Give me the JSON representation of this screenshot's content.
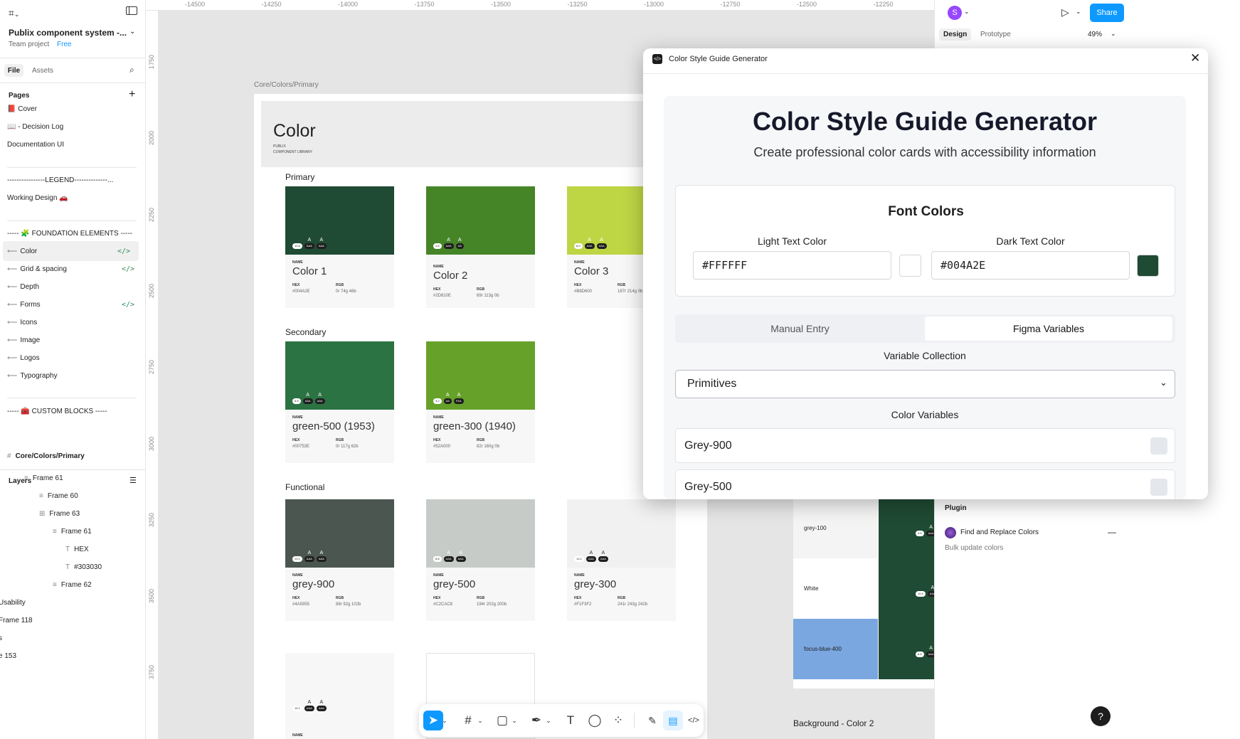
{
  "app": {
    "project_name": "Publix component system -...",
    "team": "Team project",
    "plan": "Free",
    "share": "Share",
    "avatar": "S",
    "zoom": "49%",
    "panel_tabs": [
      "Design",
      "Prototype"
    ]
  },
  "left": {
    "tabs": [
      "File",
      "Assets"
    ],
    "pages_title": "Pages",
    "pages": [
      {
        "label": "📕 Cover"
      },
      {
        "label": "📖 - Decision Log"
      },
      {
        "label": "Documentation UI"
      },
      {
        "label": "----------------LEGEND--------------..."
      },
      {
        "label": "Working Design 🚗"
      },
      {
        "label": "----- 🧩 FOUNDATION ELEMENTS -----"
      },
      {
        "label": "Color",
        "code": "</>"
      },
      {
        "label": "Grid & spacing",
        "code": "</>"
      },
      {
        "label": "Depth"
      },
      {
        "label": "Forms",
        "code": "</>"
      },
      {
        "label": "Icons"
      },
      {
        "label": "Image"
      },
      {
        "label": "Logos"
      },
      {
        "label": "Typography"
      },
      {
        "label": "----- 🧰 CUSTOM BLOCKS -----"
      }
    ],
    "layers_title": "Layers",
    "layers": [
      {
        "label": "Core/Colors/Primary"
      },
      {
        "label": "Frame 61"
      },
      {
        "label": "Frame 60"
      },
      {
        "label": "Frame 63"
      },
      {
        "label": "Frame 61"
      },
      {
        "label": "HEX"
      },
      {
        "label": "#303030"
      },
      {
        "label": "Frame 62"
      },
      {
        "label": "Usability"
      },
      {
        "label": "Frame 118"
      },
      {
        "label": "s"
      },
      {
        "label": "e 153"
      }
    ]
  },
  "ruler": {
    "top": [
      "-14500",
      "-14250",
      "-14000",
      "-13750",
      "-13500",
      "-13250",
      "-13000",
      "-12750",
      "-12500",
      "-12250"
    ],
    "left": [
      "1750",
      "2000",
      "2250",
      "2500",
      "2750",
      "3000",
      "3250",
      "3500",
      "3750"
    ]
  },
  "canvas": {
    "frame_label": "Core/Colors/Primary",
    "header_title": "Color",
    "header_sub1": "PUBLIX",
    "header_sub2": "COMPONENT LIBRARY",
    "field_name": "NAME",
    "field_hex": "HEX",
    "field_rgb": "RGB",
    "sections": [
      {
        "title": "Primary",
        "cards": [
          {
            "name": "Color 1",
            "color": "#1f4a33",
            "hex": "#004A2E",
            "rgb": "0r 74g 46b",
            "ratio": "10.8",
            "a1": "AAA",
            "a2": "AAA"
          },
          {
            "name": "Color 2",
            "color": "#468428",
            "hex": "#2D810E",
            "rgb": "69r 113g 0b",
            "ratio": "4.5",
            "a1": "AAA",
            "a2": "AA"
          },
          {
            "name": "Color 3",
            "color": "#bed544",
            "hex": "#B8D600",
            "rgb": "187r 214g 0b",
            "ratio": "8.9",
            "a1": "AAA",
            "a2": "AAA"
          }
        ]
      },
      {
        "title": "Secondary",
        "cards": [
          {
            "name": "green-500 (1953)",
            "color": "#2c7344",
            "hex": "#00753E",
            "rgb": "0r 117g 62b",
            "ratio": "5.5",
            "a1": "AAA",
            "a2": "AAA"
          },
          {
            "name": "green-300 (1940)",
            "color": "#66a129",
            "hex": "#52A000",
            "rgb": "82r 160g 0b",
            "ratio": "3.2",
            "a1": "AA",
            "a2": "FAIL"
          }
        ]
      },
      {
        "title": "Functional",
        "cards": [
          {
            "name": "grey-900",
            "color": "#4b5650",
            "hex": "#4A5955",
            "rgb": "88r 92g 102b",
            "ratio": "13.2",
            "a1": "AAA",
            "a2": "AAA"
          },
          {
            "name": "grey-500",
            "color": "#c6cbc8",
            "hex": "#C2CAC8",
            "rgb": "194r 202g 200b",
            "ratio": "8.8",
            "a1": "AAA",
            "a2": "AAA"
          },
          {
            "name": "grey-300",
            "color": "#f0f1f0",
            "hex": "#F1F3F2",
            "rgb": "241r 243g 242b",
            "ratio": "13.2",
            "a1": "AAA",
            "a2": "AAA"
          }
        ]
      }
    ],
    "bottom_ratio": "14.1",
    "bottom_a1": "AAA",
    "bottom_a2": "AAA"
  },
  "right_canvas": {
    "rows": [
      {
        "label": "grey-100",
        "ratio": "9.5"
      },
      {
        "label": "White",
        "ratio": "10.4"
      },
      {
        "label": "focus-blue-400",
        "ratio": "6.5"
      }
    ],
    "aaa": "AAA",
    "caption": "Background  - Color 2",
    "plugin_title": "Plugin",
    "plugin_name": "Find and Replace Colors",
    "plugin_desc": "Bulk update colors",
    "plugin_dash": "—"
  },
  "dialog": {
    "title": "Color Style Guide Generator",
    "heading": "Color Style Guide Generator",
    "subheading": "Create professional color cards with accessibility information",
    "font_colors": "Font Colors",
    "light_label": "Light Text Color",
    "light_value": "#FFFFFF",
    "dark_label": "Dark Text Color",
    "dark_value": "#004A2E",
    "tab_manual": "Manual Entry",
    "tab_figma": "Figma Variables",
    "collection_label": "Variable Collection",
    "collection_value": "Primitives",
    "variables_label": "Color Variables",
    "variables": [
      "Grey-900",
      "Grey-500"
    ]
  },
  "colors": {
    "accent": "#0d99ff",
    "light_swatch": "#FFFFFF",
    "dark_swatch": "#1f4a33",
    "active_page": "#f0f0f0",
    "focus_blue": "#7aa7e0"
  },
  "help": "?"
}
